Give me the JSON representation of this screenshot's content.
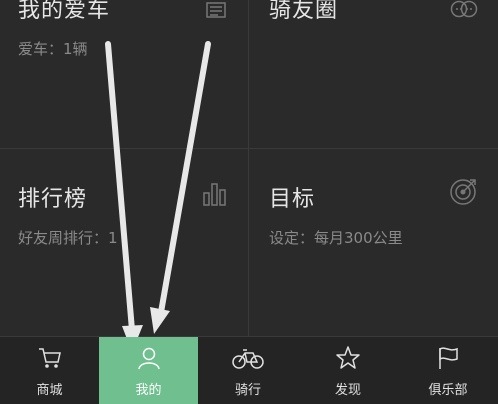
{
  "tiles": {
    "car": {
      "title": "我的爱车",
      "sub": "爱车：1辆",
      "icon": "list-icon"
    },
    "circle": {
      "title": "骑友圈",
      "sub": "",
      "icon": "chat-bubbles-icon"
    },
    "rank": {
      "title": "排行榜",
      "sub": "好友周排行：1",
      "icon": "bar-chart-icon"
    },
    "goal": {
      "title": "目标",
      "sub": "设定：每月300公里",
      "icon": "target-icon"
    }
  },
  "tabs": [
    {
      "label": "商城",
      "icon": "cart-icon"
    },
    {
      "label": "我的",
      "icon": "user-icon",
      "active": true
    },
    {
      "label": "骑行",
      "icon": "bicycle-icon"
    },
    {
      "label": "发现",
      "icon": "star-icon"
    },
    {
      "label": "俱乐部",
      "icon": "flag-icon"
    }
  ],
  "colors": {
    "background": "#2a2a2a",
    "active_tab": "#6fbf8f",
    "tabbar": "#242424"
  }
}
